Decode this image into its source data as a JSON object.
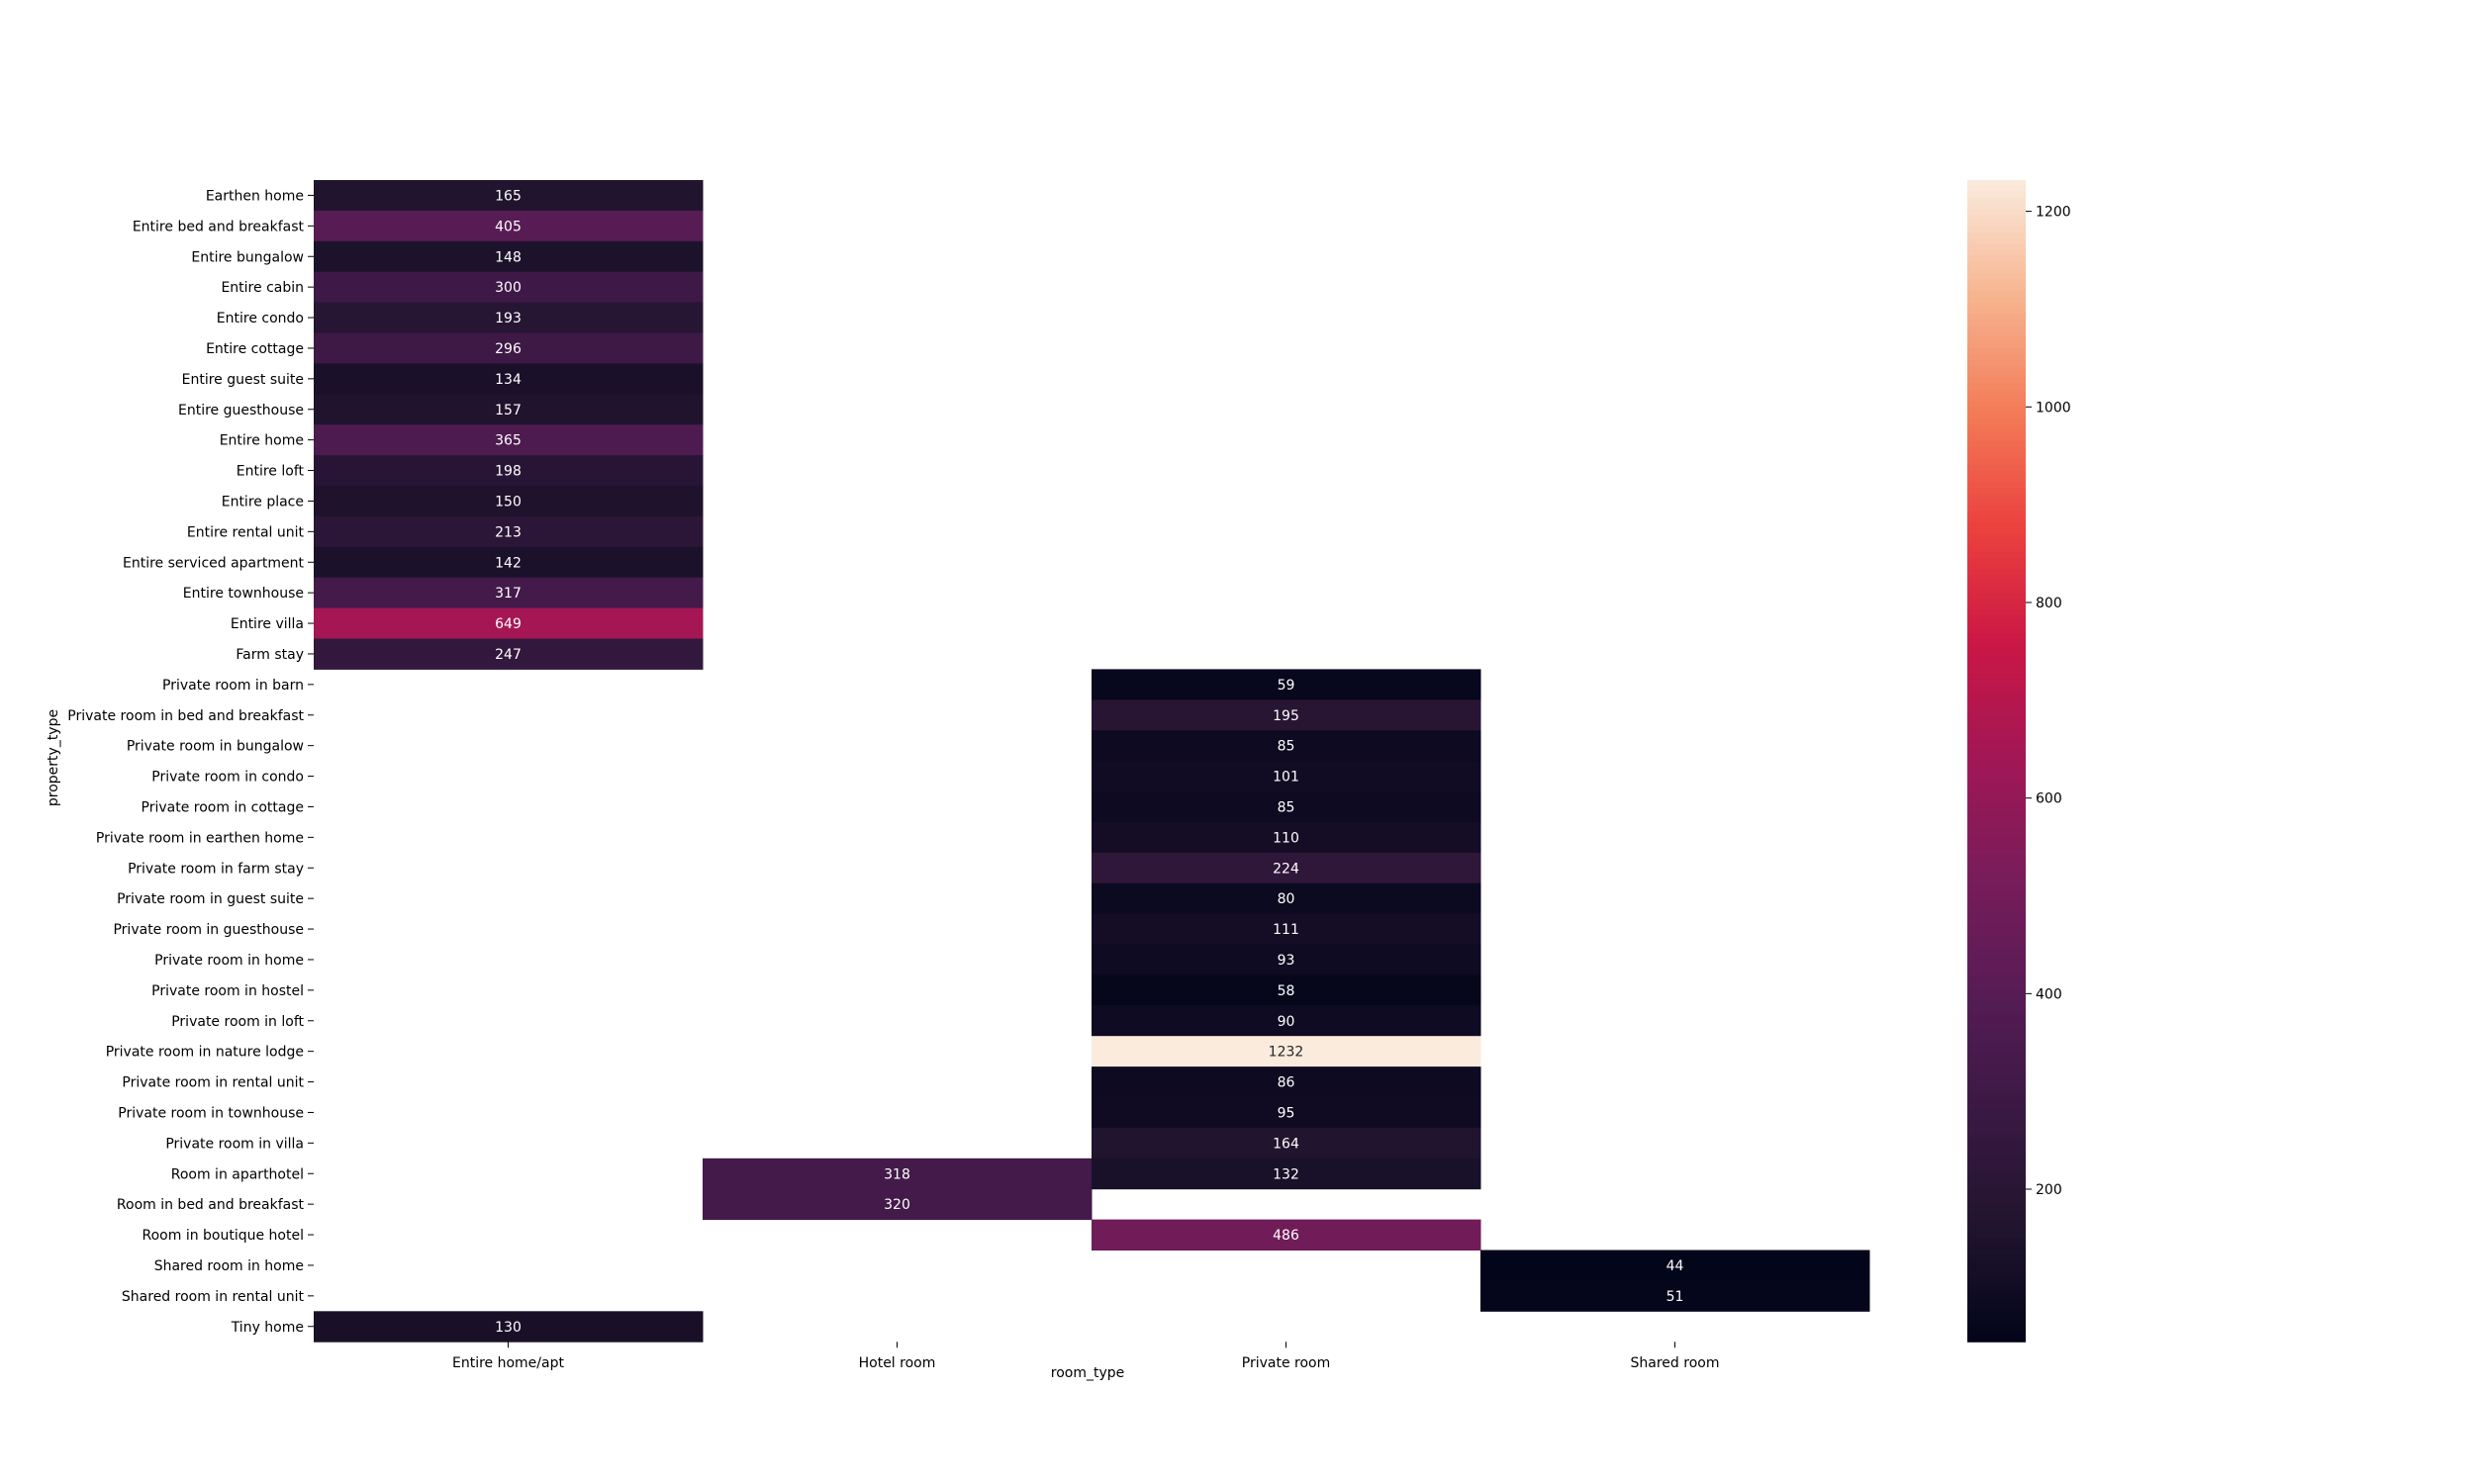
{
  "chart_data": {
    "type": "heatmap",
    "title": "",
    "xlabel": "room_type",
    "ylabel": "property_type",
    "x_categories": [
      "Entire home/apt",
      "Hotel room",
      "Private room",
      "Shared room"
    ],
    "y_categories": [
      "Earthen home",
      "Entire bed and breakfast",
      "Entire bungalow",
      "Entire cabin",
      "Entire condo",
      "Entire cottage",
      "Entire guest suite",
      "Entire guesthouse",
      "Entire home",
      "Entire loft",
      "Entire place",
      "Entire rental unit",
      "Entire serviced apartment",
      "Entire townhouse",
      "Entire villa",
      "Farm stay",
      "Private room in barn",
      "Private room in bed and breakfast",
      "Private room in bungalow",
      "Private room in condo",
      "Private room in cottage",
      "Private room in earthen home",
      "Private room in farm stay",
      "Private room in guest suite",
      "Private room in guesthouse",
      "Private room in home",
      "Private room in hostel",
      "Private room in loft",
      "Private room in nature lodge",
      "Private room in rental unit",
      "Private room in townhouse",
      "Private room in villa",
      "Room in aparthotel",
      "Room in bed and breakfast",
      "Room in boutique hotel",
      "Shared room in home",
      "Shared room in rental unit",
      "Tiny home"
    ],
    "values": [
      [
        165,
        null,
        null,
        null
      ],
      [
        405,
        null,
        null,
        null
      ],
      [
        148,
        null,
        null,
        null
      ],
      [
        300,
        null,
        null,
        null
      ],
      [
        193,
        null,
        null,
        null
      ],
      [
        296,
        null,
        null,
        null
      ],
      [
        134,
        null,
        null,
        null
      ],
      [
        157,
        null,
        null,
        null
      ],
      [
        365,
        null,
        null,
        null
      ],
      [
        198,
        null,
        null,
        null
      ],
      [
        150,
        null,
        null,
        null
      ],
      [
        213,
        null,
        null,
        null
      ],
      [
        142,
        null,
        null,
        null
      ],
      [
        317,
        null,
        null,
        null
      ],
      [
        649,
        null,
        null,
        null
      ],
      [
        247,
        null,
        null,
        null
      ],
      [
        null,
        null,
        59,
        null
      ],
      [
        null,
        null,
        195,
        null
      ],
      [
        null,
        null,
        85,
        null
      ],
      [
        null,
        null,
        101,
        null
      ],
      [
        null,
        null,
        85,
        null
      ],
      [
        null,
        null,
        110,
        null
      ],
      [
        null,
        null,
        224,
        null
      ],
      [
        null,
        null,
        80,
        null
      ],
      [
        null,
        null,
        111,
        null
      ],
      [
        null,
        null,
        93,
        null
      ],
      [
        null,
        null,
        58,
        null
      ],
      [
        null,
        null,
        90,
        null
      ],
      [
        null,
        null,
        1232,
        null
      ],
      [
        null,
        null,
        86,
        null
      ],
      [
        null,
        null,
        95,
        null
      ],
      [
        null,
        null,
        164,
        null
      ],
      [
        null,
        318,
        132,
        null
      ],
      [
        null,
        320,
        null,
        null
      ],
      [
        null,
        null,
        486,
        null
      ],
      [
        null,
        null,
        null,
        44
      ],
      [
        null,
        null,
        null,
        51
      ],
      [
        130,
        null,
        null,
        null
      ]
    ],
    "colormap": "rocket",
    "colorbar_range": [
      44,
      1232
    ],
    "colorbar_ticks": [
      200,
      400,
      600,
      800,
      1000,
      1200
    ],
    "colors": {
      "low": "#03051a",
      "high": "#faebdd",
      "label_light": "#ffffff",
      "label_dark": "#262626"
    }
  }
}
